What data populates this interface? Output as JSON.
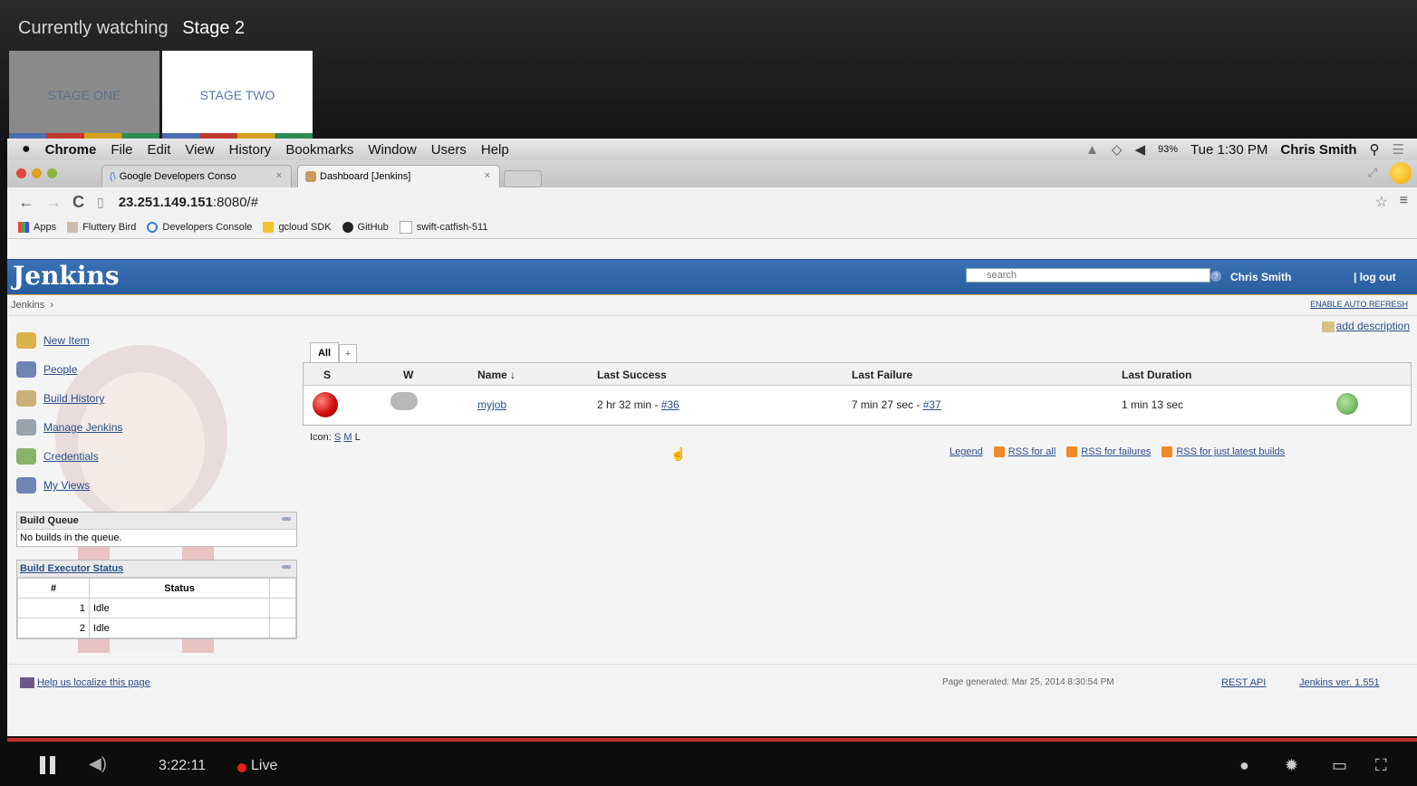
{
  "stage_bar": {
    "watching_label": "Currently watching",
    "current_stage": "Stage 2",
    "stages": [
      {
        "label": "STAGE ONE",
        "active": false
      },
      {
        "label": "STAGE TWO",
        "active": true
      }
    ]
  },
  "mac_menu": {
    "app": "Chrome",
    "items": [
      "File",
      "Edit",
      "View",
      "History",
      "Bookmarks",
      "Window",
      "Users",
      "Help"
    ],
    "battery": "93%",
    "clock": "Tue 1:30 PM",
    "user": "Chris Smith"
  },
  "browser": {
    "tabs": [
      {
        "title": "Google Developers Conso",
        "active": false
      },
      {
        "title": "Dashboard [Jenkins]",
        "active": true
      }
    ],
    "url_host": "23.251.149.151",
    "url_rest": ":8080/#",
    "bookmarks": [
      "Apps",
      "Fluttery Bird",
      "Developers Console",
      "gcloud SDK",
      "GitHub",
      "swift-catfish-511"
    ]
  },
  "jenkins": {
    "logo": "Jenkins",
    "search_placeholder": "search",
    "user": "Chris Smith",
    "logout": "| log out",
    "breadcrumb": "Jenkins",
    "auto_refresh": "ENABLE AUTO REFRESH",
    "add_description": "add description",
    "sidebar": [
      {
        "label": "New Item",
        "icon": "new-item-icon"
      },
      {
        "label": "People",
        "icon": "people-icon"
      },
      {
        "label": "Build History",
        "icon": "build-history-icon"
      },
      {
        "label": "Manage Jenkins",
        "icon": "manage-icon"
      },
      {
        "label": "Credentials",
        "icon": "credentials-icon"
      },
      {
        "label": "My Views",
        "icon": "views-icon"
      }
    ],
    "build_queue": {
      "title": "Build Queue",
      "empty": "No builds in the queue."
    },
    "executor": {
      "title": "Build Executor Status",
      "col_num": "#",
      "col_status": "Status",
      "rows": [
        {
          "num": "1",
          "status": "Idle"
        },
        {
          "num": "2",
          "status": "Idle"
        }
      ]
    },
    "view_tabs": [
      "All",
      "+"
    ],
    "table_headers": [
      "S",
      "W",
      "Name ↓",
      "Last Success",
      "Last Failure",
      "Last Duration"
    ],
    "jobs": [
      {
        "name": "myjob",
        "last_success_text": "2 hr 32 min - ",
        "last_success_link": "#36",
        "last_failure_text": "7 min 27 sec - ",
        "last_failure_link": "#37",
        "last_duration": "1 min 13 sec"
      }
    ],
    "icon_size_label": "Icon:",
    "icon_sizes": [
      "S",
      "M",
      "L"
    ],
    "legend": "Legend",
    "rss_all": "RSS for all",
    "rss_failures": "RSS for failures",
    "rss_latest": "RSS for just latest builds",
    "help_localize": "Help us localize this page",
    "page_generated": "Page generated: Mar 25, 2014 8:30:54 PM",
    "rest_api": "REST API",
    "version": "Jenkins ver. 1.551"
  },
  "player": {
    "time": "3:22:11",
    "live": "Live"
  },
  "colors": {
    "jenkins_blue": "#2a5ea0",
    "live_red": "#e62117"
  }
}
